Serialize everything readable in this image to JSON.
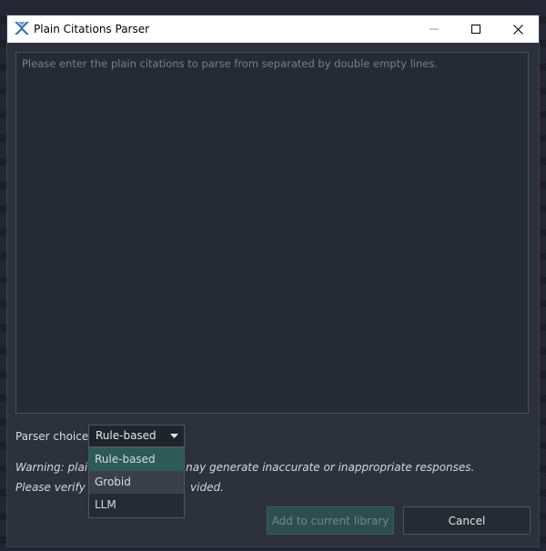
{
  "window": {
    "title": "Plain Citations Parser",
    "icons": {
      "app": "app-logo-icon",
      "minimize": "minimize-icon",
      "maximize": "maximize-icon",
      "close": "close-icon"
    }
  },
  "input": {
    "placeholder": "Please enter the plain citations to parse from separated by double empty lines.",
    "value": ""
  },
  "parser": {
    "label": "Parser choice",
    "selected": "Rule-based",
    "options": [
      "Rule-based",
      "Grobid",
      "LLM"
    ],
    "arrow_icon": "dropdown-arrow-icon"
  },
  "warning": {
    "line1_before": "Warning: plai",
    "line1_after": "nay generate inaccurate or inappropriate responses.",
    "line2_before": "Please verify a",
    "line2_after": "vided."
  },
  "buttons": {
    "add_label": "Add to current library",
    "cancel_label": "Cancel"
  },
  "colors": {
    "accent": "#2c5a56",
    "window_bg": "#2d313c"
  }
}
